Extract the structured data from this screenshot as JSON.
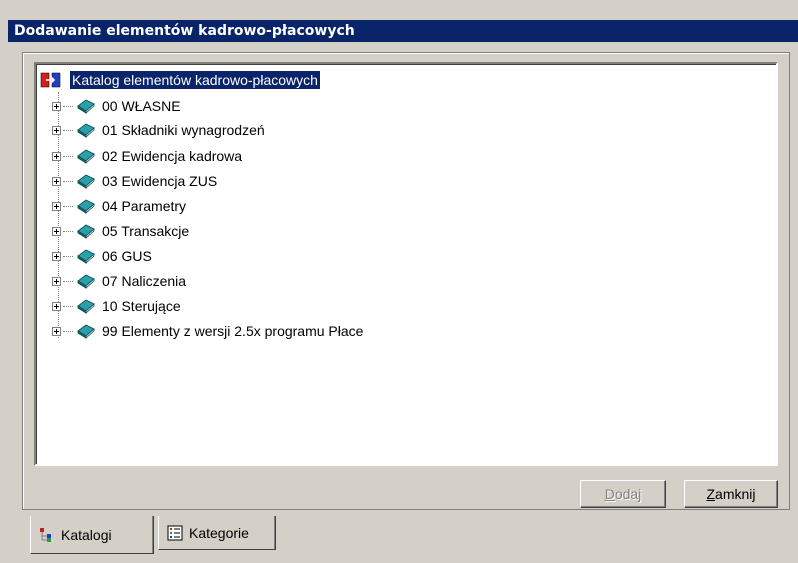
{
  "window": {
    "title": "Dodawanie elementów kadrowo-płacowych"
  },
  "tree": {
    "root_label": "Katalog elementów kadrowo-płacowych",
    "items": [
      {
        "label": "00 WŁASNE",
        "icon": "book-icon"
      },
      {
        "label": "01 Składniki wynagrodzeń",
        "icon": "book-icon"
      },
      {
        "label": "02 Ewidencja kadrowa",
        "icon": "book-icon"
      },
      {
        "label": "03 Ewidencja ZUS",
        "icon": "book-icon"
      },
      {
        "label": "04 Parametry",
        "icon": "book-icon"
      },
      {
        "label": "05 Transakcje",
        "icon": "book-icon"
      },
      {
        "label": "06 GUS",
        "icon": "book-icon"
      },
      {
        "label": "07 Naliczenia",
        "icon": "book-icon"
      },
      {
        "label": "10 Sterujące",
        "icon": "book-icon"
      },
      {
        "label": "99 Elementy z wersji 2.5x programu Płace",
        "icon": "book-icon"
      }
    ]
  },
  "buttons": {
    "add": {
      "mnemonic": "D",
      "rest": "odaj",
      "enabled": false
    },
    "close": {
      "mnemonic": "Z",
      "rest": "amknij",
      "enabled": true
    }
  },
  "tabs": [
    {
      "label": "Katalogi",
      "active": true,
      "icon": "tree-icon"
    },
    {
      "label": "Kategorie",
      "active": false,
      "icon": "list-icon"
    }
  ],
  "colors": {
    "titlebar": "#0a246a",
    "selection": "#0a246a",
    "book": "#1e7f8f",
    "face": "#d4d0c8"
  }
}
